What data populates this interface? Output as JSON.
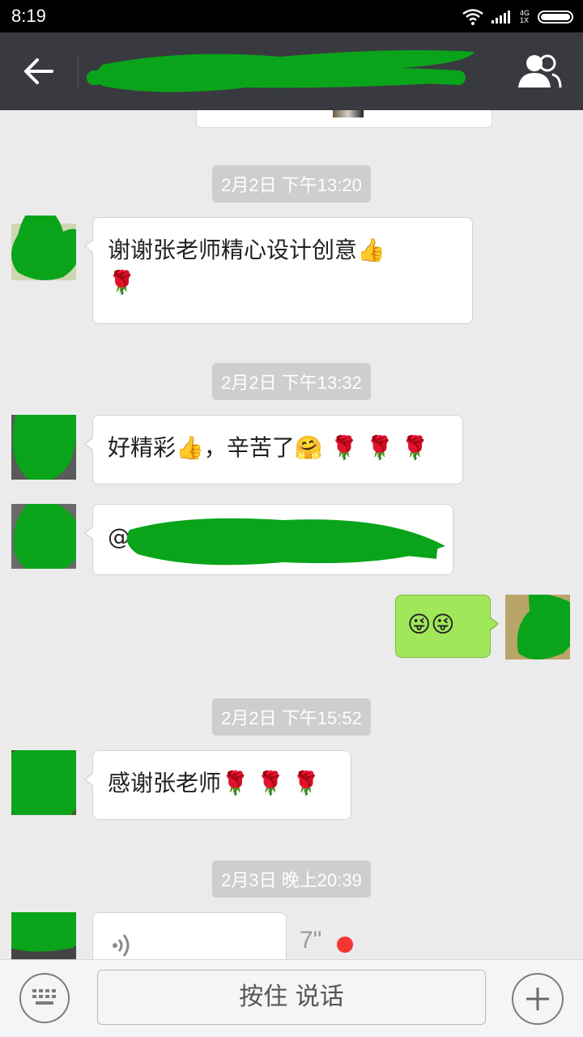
{
  "status_bar": {
    "time": "8:19",
    "network_type": "4G",
    "sim_label": "1X"
  },
  "header": {
    "back_icon": "back-arrow-icon",
    "title": "",
    "group_icon": "people-icon"
  },
  "messages": [
    {
      "timestamp": "2月2日 下午13:20"
    },
    {
      "sender": "left",
      "text": "谢谢张老师精心设计创意",
      "emojis": [
        "👍",
        "🌹"
      ]
    },
    {
      "timestamp": "2月2日 下午13:32"
    },
    {
      "sender": "left",
      "text": "好精彩",
      "text2": "，辛苦了",
      "emojis": [
        "👍",
        "🤗",
        "🌹",
        "🌹",
        "🌹"
      ]
    },
    {
      "sender": "left",
      "text": "@"
    },
    {
      "sender": "right",
      "emojis": [
        "😜",
        "😜"
      ]
    },
    {
      "timestamp": "2月2日 下午15:52"
    },
    {
      "sender": "left",
      "text": "感谢张老师",
      "emojis": [
        "🌹",
        "🌹",
        "🌹"
      ]
    },
    {
      "timestamp": "2月3日 晚上20:39"
    },
    {
      "sender": "left",
      "type": "voice",
      "duration": "7\"",
      "unread": true
    }
  ],
  "input_bar": {
    "keyboard_icon": "keyboard-icon",
    "hold_to_talk_label": "按住 说话",
    "add_icon": "plus-icon"
  },
  "colors": {
    "top_bar": "#393a3f",
    "chat_background": "#ebebeb",
    "outgoing_bubble": "#a0e75a",
    "timestamp_bg": "#cecece",
    "redaction": "#0aa41a",
    "unread_dot": "#f43530"
  }
}
